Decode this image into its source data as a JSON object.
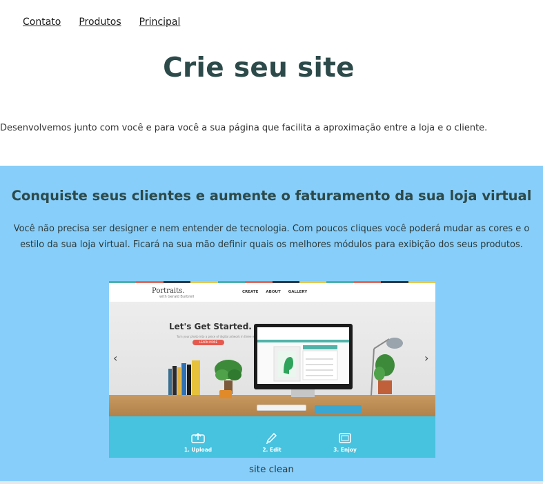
{
  "nav": {
    "items": [
      {
        "label": "Contato"
      },
      {
        "label": "Produtos"
      },
      {
        "label": "Principal"
      }
    ]
  },
  "hero": {
    "title": "Crie seu site",
    "intro": "Desenvolvemos junto com você e para você a sua página que facilita a aproximação entre a loja e o cliente."
  },
  "feature": {
    "title": "Conquiste seus clientes e aumente o faturamento da sua loja virtual",
    "text": "Você não precisa ser designer e nem entender de tecnologia. Com poucos cliques você poderá mudar as cores e o estilo da sua loja virtual. Ficará na sua mão definir quais os melhores módulos para exibição dos seus produtos.",
    "caption": "site clean"
  },
  "screenshot": {
    "logo": "Portraits.",
    "logo_sub": "with Gerald Burbrell",
    "menu": [
      "CREATE",
      "ABOUT",
      "GALLERY"
    ],
    "headline": "Let's Get Started.",
    "subline": "Turn your photo into a piece of digital artwork in three easy steps.",
    "button": "LEARN MORE",
    "steps": [
      {
        "label": "1. Upload",
        "icon": "upload-icon"
      },
      {
        "label": "2. Edit",
        "icon": "pencil-icon"
      },
      {
        "label": "3. Enjoy",
        "icon": "frame-icon"
      }
    ]
  },
  "colors": {
    "band": "#87cefa",
    "title": "#2d4a4a",
    "steps_bar": "#47c2df",
    "stripe": [
      "#4fb3a9",
      "#e36b5c",
      "#2f3b4b",
      "#e9c94b",
      "#4fb3a9",
      "#e36b5c",
      "#2f3b4b",
      "#e9c94b",
      "#4fb3a9",
      "#e36b5c",
      "#2f3b4b",
      "#e9c94b"
    ]
  }
}
